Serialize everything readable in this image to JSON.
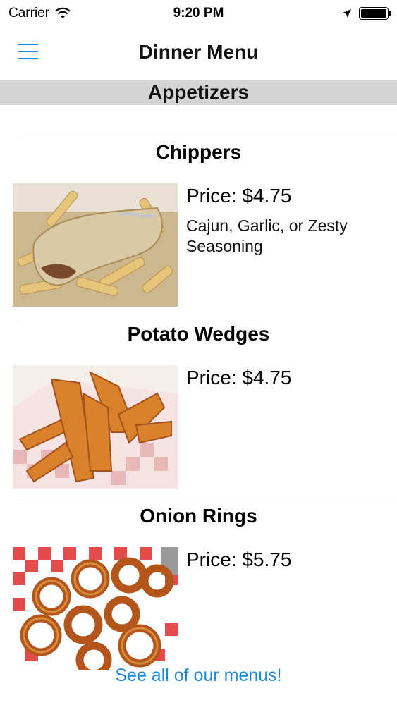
{
  "status_bar": {
    "carrier": "Carrier",
    "time": "9:20 PM"
  },
  "nav": {
    "title": "Dinner Menu",
    "menu_icon": "hamburger-menu-icon"
  },
  "section": {
    "title": "Appetizers"
  },
  "items": [
    {
      "name": "Chippers",
      "price": "Price: $4.75",
      "description": "Cajun, Garlic, or Zesty Seasoning",
      "photo": "chippers-photo"
    },
    {
      "name": "Potato Wedges",
      "price": "Price: $4.75",
      "description": "",
      "photo": "potato-wedges-photo"
    },
    {
      "name": "Onion Rings",
      "price": "Price: $5.75",
      "description": "",
      "photo": "onion-rings-photo"
    }
  ],
  "footer": {
    "link_label": "See all of our menus!"
  },
  "colors": {
    "accent": "#1a8ae5",
    "section_bg": "#d4d4d4",
    "divider": "#c8c8c8"
  }
}
